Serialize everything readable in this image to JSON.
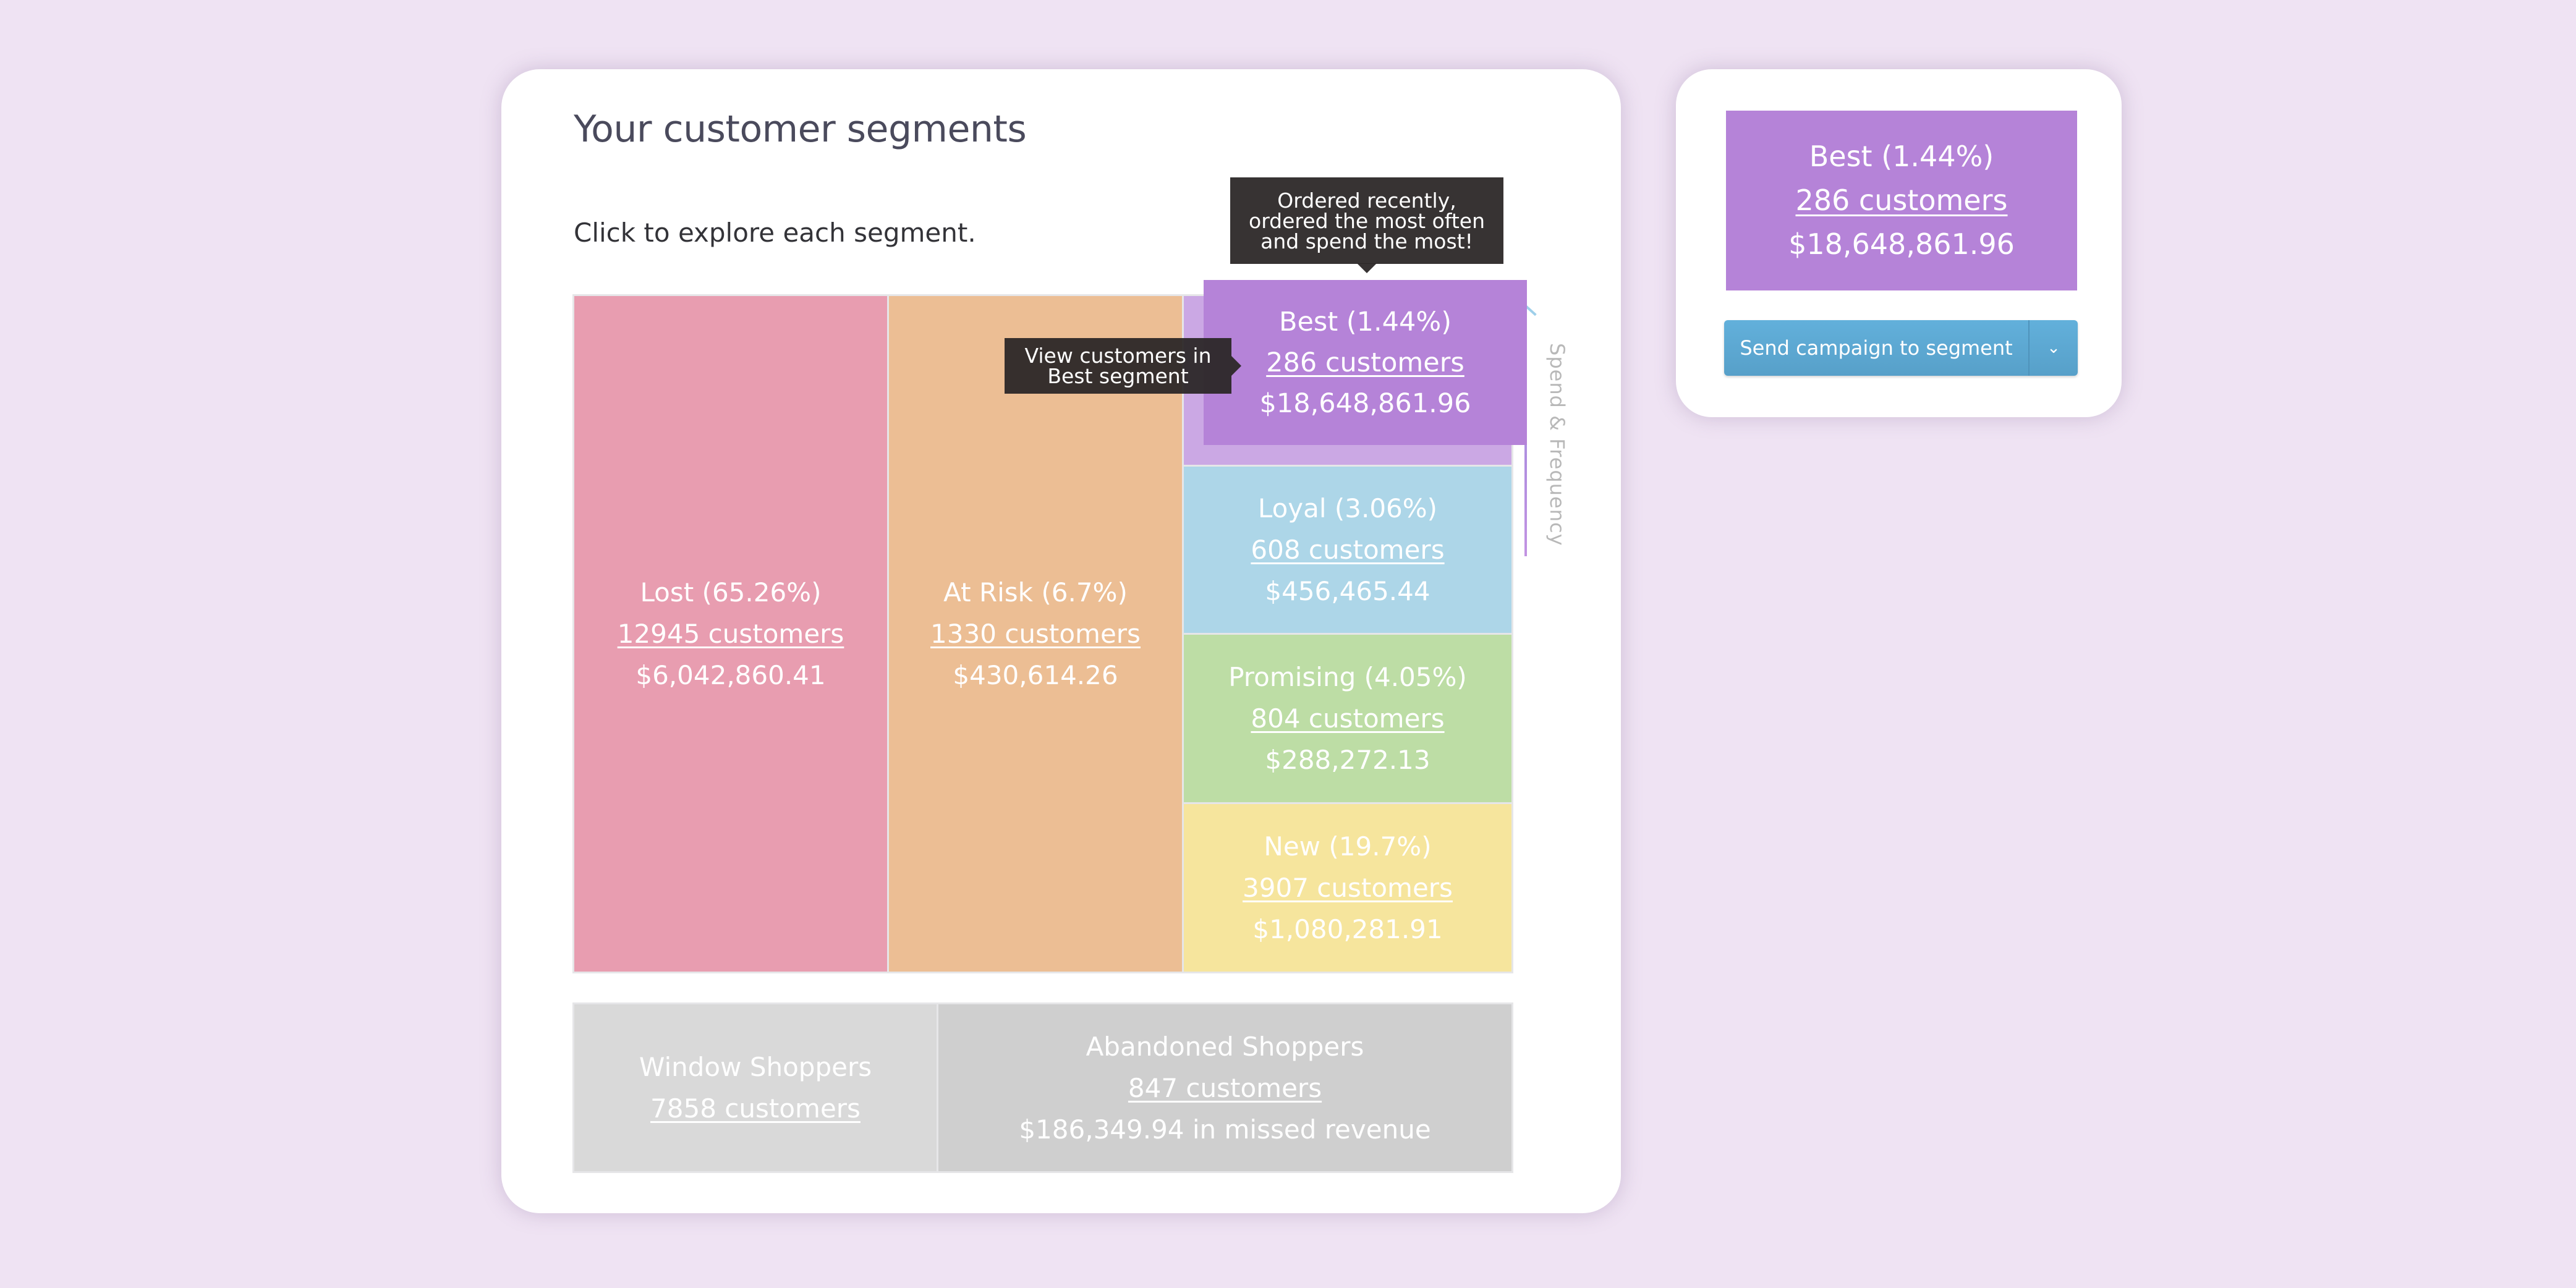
{
  "main": {
    "title": "Your customer segments",
    "subtitle": "Click to explore each segment."
  },
  "segments": {
    "lost": {
      "label": "Lost (65.26%)",
      "name": "Lost",
      "percent": 65.26,
      "customers": "12945 customers",
      "customer_count": 12945,
      "revenue": "$6,042,860.41",
      "color": "#e89db0"
    },
    "at_risk": {
      "label": "At Risk (6.7%)",
      "name": "At Risk",
      "percent": 6.7,
      "customers": "1330 customers",
      "customer_count": 1330,
      "revenue": "$430,614.26",
      "color": "#ecbe94"
    },
    "best": {
      "label": "Best (1.44%)",
      "name": "Best",
      "percent": 1.44,
      "customers": "286 customers",
      "customer_count": 286,
      "revenue": "$18,648,861.96",
      "color": "#b583d8",
      "cell_color": "#cba8e4"
    },
    "loyal": {
      "label": "Loyal (3.06%)",
      "name": "Loyal",
      "percent": 3.06,
      "customers": "608 customers",
      "customer_count": 608,
      "revenue": "$456,465.44",
      "color": "#add6e8"
    },
    "promising": {
      "label": "Promising (4.05%)",
      "name": "Promising",
      "percent": 4.05,
      "customers": "804 customers",
      "customer_count": 804,
      "revenue": "$288,272.13",
      "color": "#bddda5"
    },
    "new": {
      "label": "New (19.7%)",
      "name": "New",
      "percent": 19.7,
      "customers": "3907 customers",
      "customer_count": 3907,
      "revenue": "$1,080,281.91",
      "color": "#f6e59d"
    }
  },
  "other_segments": {
    "window_shoppers": {
      "label": "Window Shoppers",
      "customers": "7858 customers",
      "customer_count": 7858,
      "color": "#d9d9d9"
    },
    "abandoned_shoppers": {
      "label": "Abandoned Shoppers",
      "customers": "847 customers",
      "customer_count": 847,
      "revenue": "$186,349.94 in missed revenue",
      "color": "#cfcfcf"
    }
  },
  "tooltips": {
    "best_description": "Ordered recently, ordered the most often and spend the most!",
    "view_customers": "View customers in Best segment"
  },
  "axis": {
    "label": "Spend & Frequency"
  },
  "selected": {
    "label": "Best (1.44%)",
    "customers": "286 customers",
    "revenue": "$18,648,861.96",
    "campaign_button": "Send campaign to segment",
    "dropdown_icon": "chevron-down-icon",
    "dropdown_glyph": "⌄"
  },
  "colors": {
    "background": "#efe3f3",
    "card": "#ffffff",
    "button": "#5eaad6",
    "tooltip": "#2a2626"
  }
}
